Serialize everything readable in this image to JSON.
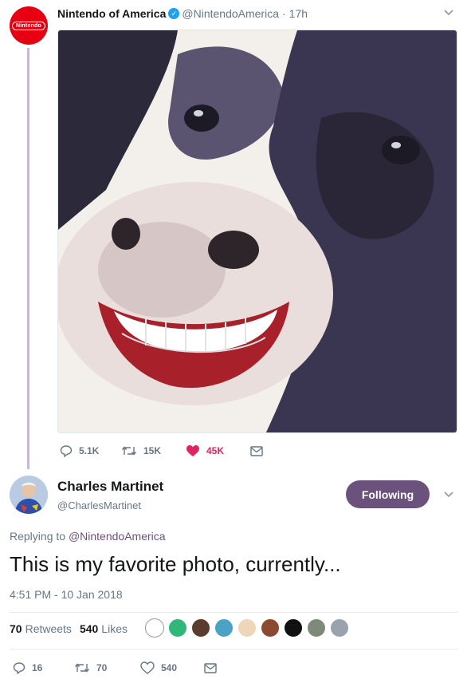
{
  "parent_tweet": {
    "avatar_text": "Nintendo",
    "author_name": "Nintendo of America",
    "handle": "@NintendoAmerica",
    "separator": "·",
    "time": "17h",
    "actions": {
      "replies": "5.1K",
      "retweets": "15K",
      "likes": "45K"
    },
    "colors": {
      "liked": "#e0245e",
      "thread_line": "#c4b9d9"
    }
  },
  "reply_tweet": {
    "author_name": "Charles Martinet",
    "handle": "@CharlesMartinet",
    "follow_label": "Following",
    "replying_prefix": "Replying to",
    "replying_to": "@NintendoAmerica",
    "text": "This is my favorite photo, currently...",
    "timestamp": "4:51 PM - 10 Jan 2018",
    "retweets_count": "70",
    "retweets_label": "Retweets",
    "likes_count": "540",
    "likes_label": "Likes",
    "actions": {
      "replies": "16",
      "retweets": "70",
      "likes": "540"
    },
    "colors": {
      "accent": "#6b527c"
    }
  }
}
